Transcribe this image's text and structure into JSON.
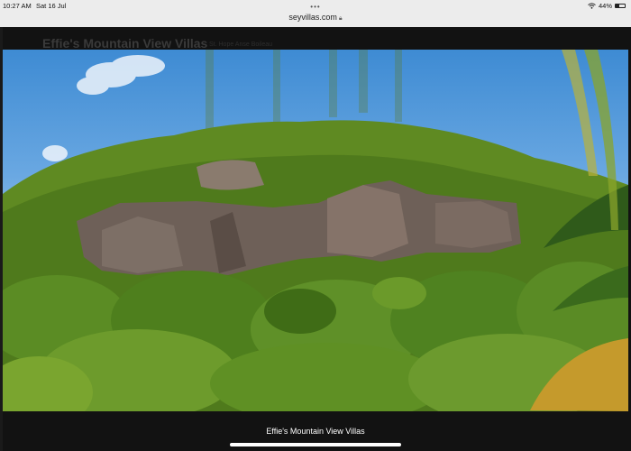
{
  "status_bar": {
    "time": "10:27 AM",
    "date": "Sat 16 Jul",
    "battery": "44%",
    "battery_level": 0.44,
    "icons": [
      "wifi-icon",
      "battery-icon"
    ]
  },
  "browser": {
    "tab_dots": "•••",
    "url": "seyvillas.com",
    "url_icon": "lock-icon"
  },
  "page": {
    "title": "Effie's Mountain View Villas",
    "subtitle": "St. Hope Anse Boileau"
  },
  "lightbox": {
    "photo_subject": "mountain",
    "caption": "Effie's Mountain View Villas"
  },
  "colors": {
    "status_bar_bg": "#ececec",
    "overlay_bg": "#0e0e0e",
    "caption_text": "#ffffff"
  }
}
